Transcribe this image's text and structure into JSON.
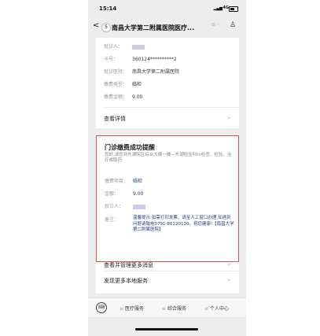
{
  "status_bar": {
    "time": "15:14",
    "network": "4G"
  },
  "nav": {
    "back": "<",
    "badge": "5",
    "title": "南昌大学第二附属医院医疗...",
    "more": "⊙ ◦"
  },
  "card1": {
    "rows": [
      {
        "label": "就诊人：",
        "value": ""
      },
      {
        "label": "卡号：",
        "value": "360124**********2"
      },
      {
        "label": "就诊医院：",
        "value": "南昌大学第二附属医院"
      },
      {
        "label": "缴费类型：",
        "value": "临检"
      },
      {
        "label": "缴费金额：",
        "value": "9.00"
      }
    ],
    "details_link": "查看详情",
    "arrow": ">"
  },
  "card2": {
    "title": "门诊缴费成功提醒",
    "desc": "您好,请您到东湖院区综合大楼一楼—东湖检验科tn检查、检验、治疗或取药",
    "rows": [
      {
        "label": "缴费项目：",
        "value": "临检"
      },
      {
        "label": "金额：",
        "value": "9.00"
      },
      {
        "label": "就诊人：",
        "value": ""
      },
      {
        "label": "备注：",
        "value": ""
      }
    ],
    "note": "温馨提示:如需打印发票，请至人工窗口办理,如遇到问题请致电0791-86120120。祝您健康!【南昌大学第二附属医院】"
  },
  "card3": {
    "manage_link": "查看并管理更多消息",
    "discover_link": "发现更多本地服务",
    "arrow": ">"
  },
  "tabbar": {
    "keyboard_icon": "⌨",
    "tabs": [
      "医疗服务",
      "综合服务",
      "个人中心"
    ]
  }
}
